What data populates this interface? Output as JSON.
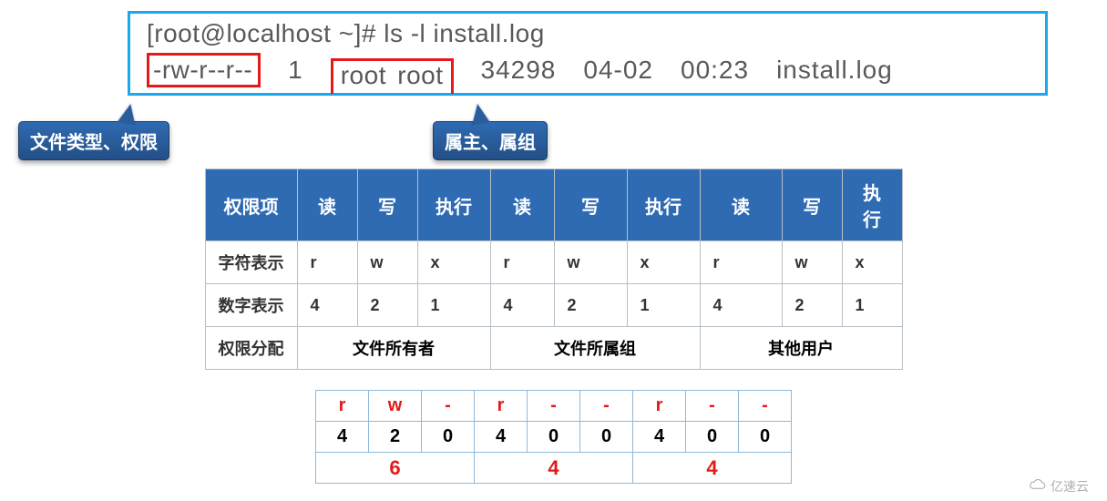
{
  "terminal": {
    "line1": "[root@localhost ~]# ls -l install.log",
    "perm": "-rw-r--r--",
    "links": "1",
    "owner_group": "root   root",
    "size": "34298",
    "date": "04-02",
    "time": "00:23",
    "filename": "install.log"
  },
  "callouts": {
    "filetype_perm": "文件类型、权限",
    "owner_group": "属主、属组"
  },
  "perm_table": {
    "headers": [
      "权限项",
      "读",
      "写",
      "执行",
      "读",
      "写",
      "执行",
      "读",
      "写",
      "执行"
    ],
    "rows": {
      "char_label": "字符表示",
      "chars": [
        "r",
        "w",
        "x",
        "r",
        "w",
        "x",
        "r",
        "w",
        "x"
      ],
      "num_label": "数字表示",
      "nums": [
        "4",
        "2",
        "1",
        "4",
        "2",
        "1",
        "4",
        "2",
        "1"
      ],
      "alloc_label": "权限分配",
      "groups": [
        "文件所有者",
        "文件所属组",
        "其他用户"
      ]
    }
  },
  "calc": {
    "symbols": [
      "r",
      "w",
      "-",
      "r",
      "-",
      "-",
      "r",
      "-",
      "-"
    ],
    "nums": [
      "4",
      "2",
      "0",
      "4",
      "0",
      "0",
      "4",
      "0",
      "0"
    ],
    "sums": [
      "6",
      "4",
      "4"
    ]
  },
  "watermark": "亿速云",
  "chart_data": {
    "type": "table",
    "title": "Linux file permission numeric mapping",
    "permission_items": {
      "read": 4,
      "write": 2,
      "execute": 1
    },
    "example": {
      "string": "rw-r--r--",
      "octal": 644,
      "owner": {
        "r": 4,
        "w": 2,
        "-": 0,
        "sum": 6
      },
      "group": {
        "r": 4,
        "-": 0,
        "-2": 0,
        "sum": 4
      },
      "other": {
        "r": 4,
        "-": 0,
        "-2": 0,
        "sum": 4
      }
    }
  }
}
